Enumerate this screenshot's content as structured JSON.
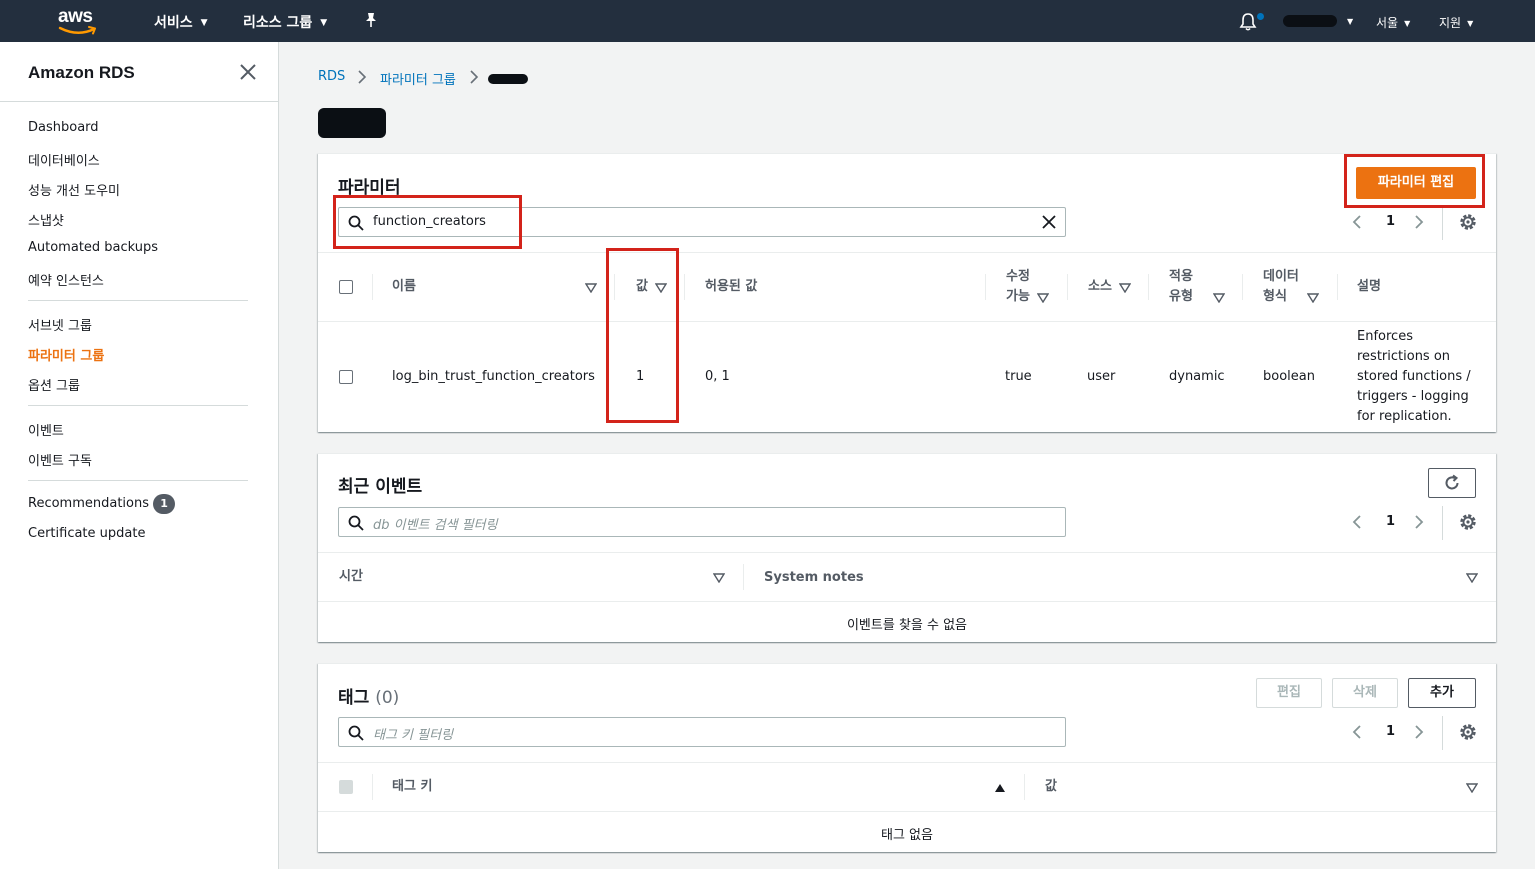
{
  "topnav": {
    "logo_text": "aws",
    "services": "서비스",
    "resource_groups": "리소스 그룹",
    "region": "서울",
    "support": "지원"
  },
  "sidebar": {
    "title": "Amazon RDS",
    "items": [
      {
        "label": "Dashboard"
      },
      {
        "label": "데이터베이스"
      },
      {
        "label": "성능 개선 도우미"
      },
      {
        "label": "스냅샷"
      },
      {
        "label": "Automated backups"
      },
      {
        "label": "예약 인스턴스"
      },
      {
        "label": "서브넷 그룹"
      },
      {
        "label": "파라미터 그룹"
      },
      {
        "label": "옵션 그룹"
      },
      {
        "label": "이벤트"
      },
      {
        "label": "이벤트 구독"
      },
      {
        "label": "Recommendations"
      },
      {
        "label": "Certificate update"
      }
    ],
    "active": "파라미터 그룹",
    "recommendations_badge": "1"
  },
  "breadcrumb": {
    "rds": "RDS",
    "parameter_groups": "파라미터 그룹"
  },
  "parameters": {
    "title": "파라미터",
    "edit_button": "파라미터 편집",
    "search_value": "function_creators",
    "page": "1",
    "columns": {
      "name": "이름",
      "value": "값",
      "allowed": "허용된 값",
      "modifiable_1": "수정",
      "modifiable_2": "가능",
      "source": "소스",
      "apply_1": "적용",
      "apply_2": "유형",
      "datatype_1": "데이터",
      "datatype_2": "형식",
      "description": "설명"
    },
    "rows": [
      {
        "name": "log_bin_trust_function_creators",
        "value": "1",
        "allowed": "0, 1",
        "modifiable": "true",
        "source": "user",
        "apply_type": "dynamic",
        "data_type": "boolean",
        "description_lines": [
          "Enforces",
          "restrictions on",
          "stored functions /",
          "triggers - logging",
          "for replication."
        ]
      }
    ]
  },
  "events": {
    "title": "최근 이벤트",
    "search_placeholder": "db 이벤트 검색 필터링",
    "page": "1",
    "col_time": "시간",
    "col_notes": "System notes",
    "empty": "이벤트를 찾을 수 없음"
  },
  "tags": {
    "title": "태그",
    "count": "(0)",
    "edit_button": "편집",
    "delete_button": "삭제",
    "add_button": "추가",
    "search_placeholder": "태그 키 필터링",
    "page": "1",
    "col_key": "태그 키",
    "col_value": "값",
    "empty": "태그 없음"
  },
  "colors": {
    "nav_bg": "#232f3e",
    "accent_orange": "#ec7211",
    "link_blue": "#0073bb",
    "highlight_red": "#d3231a"
  }
}
